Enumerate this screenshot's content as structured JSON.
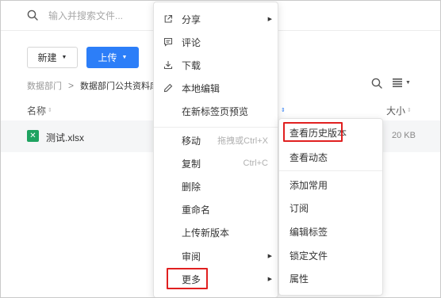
{
  "search": {
    "placeholder": "输入并搜索文件..."
  },
  "toolbar": {
    "new_label": "新建",
    "upload_label": "上传"
  },
  "breadcrumb": {
    "root": "数据部门",
    "separator": ">",
    "current": "数据部门公共资料库"
  },
  "table": {
    "col_name": "名称",
    "col_size": "大小",
    "rows": [
      {
        "name": "测试.xlsx",
        "size": "20 KB",
        "icon": "xlsx-file-icon"
      }
    ]
  },
  "context_menu": {
    "items": [
      {
        "label": "分享",
        "icon": "share-icon",
        "has_submenu": true
      },
      {
        "label": "评论",
        "icon": "comment-icon"
      },
      {
        "label": "下载",
        "icon": "download-icon"
      },
      {
        "label": "本地编辑",
        "icon": "pencil-icon"
      },
      {
        "label": "在新标签页预览"
      },
      {
        "label": "移动",
        "shortcut": "拖拽或Ctrl+X"
      },
      {
        "label": "复制",
        "shortcut": "Ctrl+C"
      },
      {
        "label": "删除"
      },
      {
        "label": "重命名"
      },
      {
        "label": "上传新版本"
      },
      {
        "label": "审阅",
        "has_submenu": true
      },
      {
        "label": "更多",
        "has_submenu": true,
        "highlighted": true
      }
    ]
  },
  "submenu": {
    "items": [
      {
        "label": "查看历史版本",
        "highlighted": true
      },
      {
        "label": "查看动态"
      },
      {
        "label": "添加常用"
      },
      {
        "label": "订阅"
      },
      {
        "label": "编辑标签"
      },
      {
        "label": "锁定文件"
      },
      {
        "label": "属性"
      }
    ]
  },
  "colors": {
    "accent": "#2c7ef8",
    "highlight_border": "#e02020",
    "excel_green": "#1fa361"
  }
}
